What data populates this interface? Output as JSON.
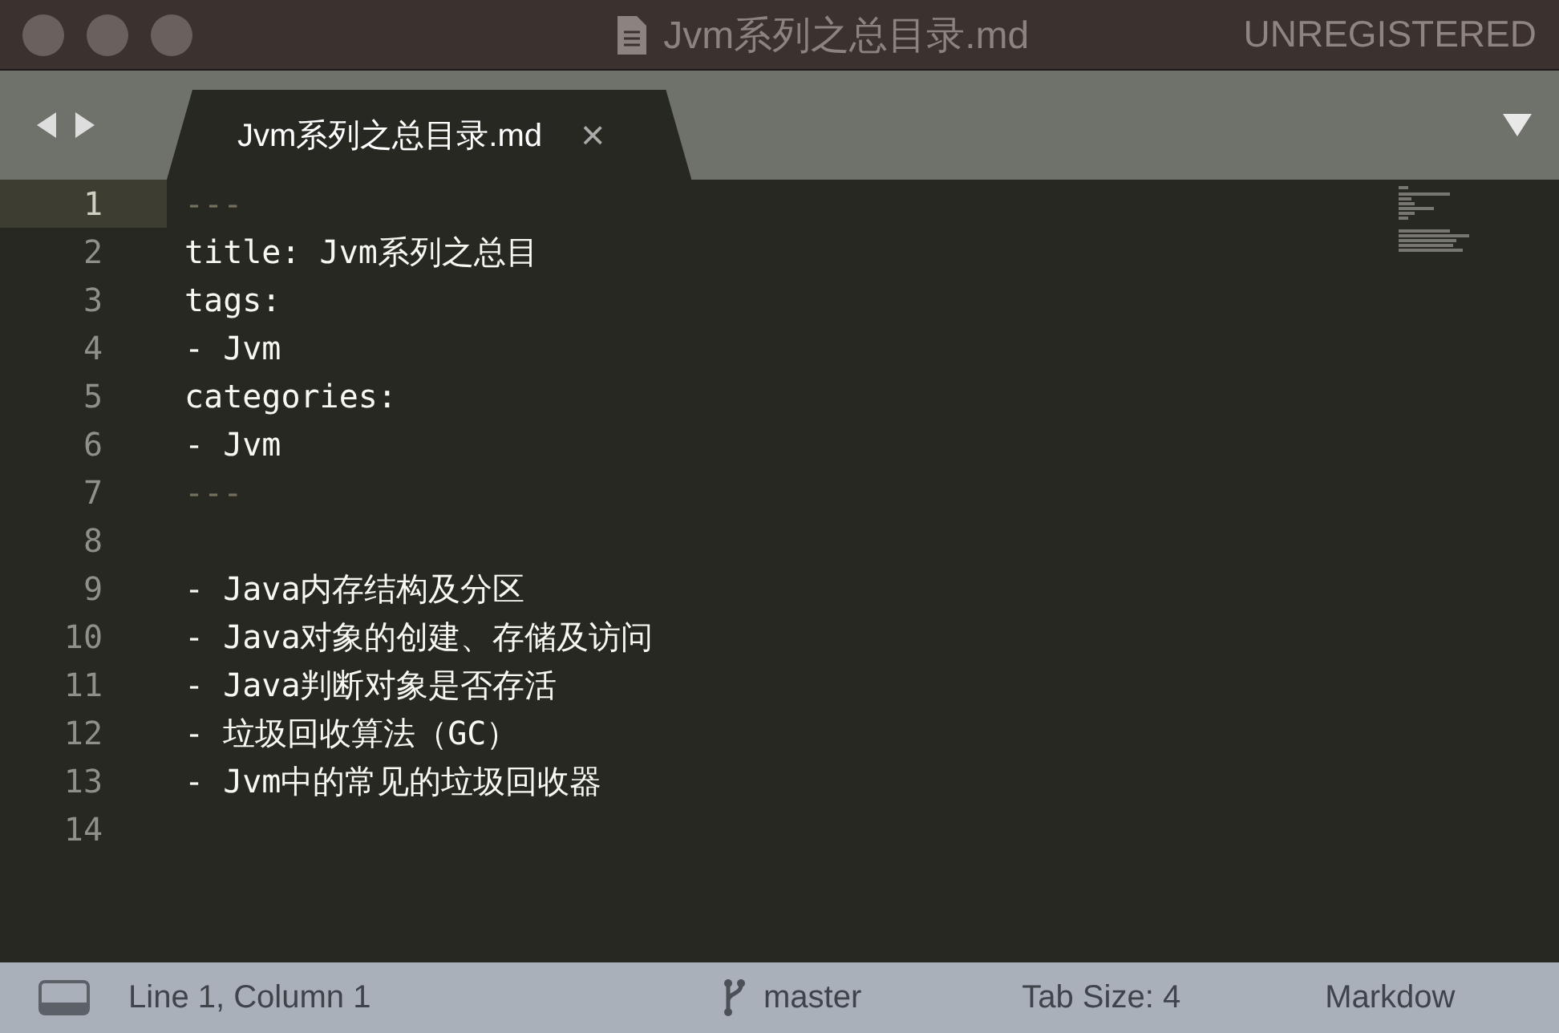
{
  "window": {
    "title": "Jvm系列之总目录.md",
    "badge": "UNREGISTERED"
  },
  "tabs": [
    {
      "label": "Jvm系列之总目录.md",
      "selected": true,
      "close": "×"
    }
  ],
  "editor": {
    "lines": [
      {
        "number": "1",
        "kind": "fence",
        "text": "---",
        "current": true
      },
      {
        "number": "2",
        "kind": "text",
        "text": "title: Jvm系列之总目",
        "current": false
      },
      {
        "number": "3",
        "kind": "text",
        "text": "tags:",
        "current": false
      },
      {
        "number": "4",
        "kind": "text",
        "text": "- Jvm",
        "current": false
      },
      {
        "number": "5",
        "kind": "text",
        "text": "categories:",
        "current": false
      },
      {
        "number": "6",
        "kind": "text",
        "text": "- Jvm",
        "current": false
      },
      {
        "number": "7",
        "kind": "fence",
        "text": "---",
        "current": false
      },
      {
        "number": "8",
        "current": false
      },
      {
        "number": "9",
        "kind": "text",
        "text": "- Java内存结构及分区",
        "current": false
      },
      {
        "number": "10",
        "kind": "text",
        "text": "- Java对象的创建、存储及访问",
        "current": false
      },
      {
        "number": "11",
        "kind": "text",
        "text": "- Java判断对象是否存活",
        "current": false
      },
      {
        "number": "12",
        "kind": "text",
        "text": "- 垃圾回收算法（GC）",
        "current": false
      },
      {
        "number": "13",
        "kind": "text",
        "text": "- Jvm中的常见的垃圾回收器",
        "current": false
      },
      {
        "number": "14",
        "current": false
      }
    ]
  },
  "status_bar": {
    "position": "Line 1, Column 1",
    "branch": "master",
    "tab_size": "Tab Size: 4",
    "syntax": "Markdow"
  }
}
